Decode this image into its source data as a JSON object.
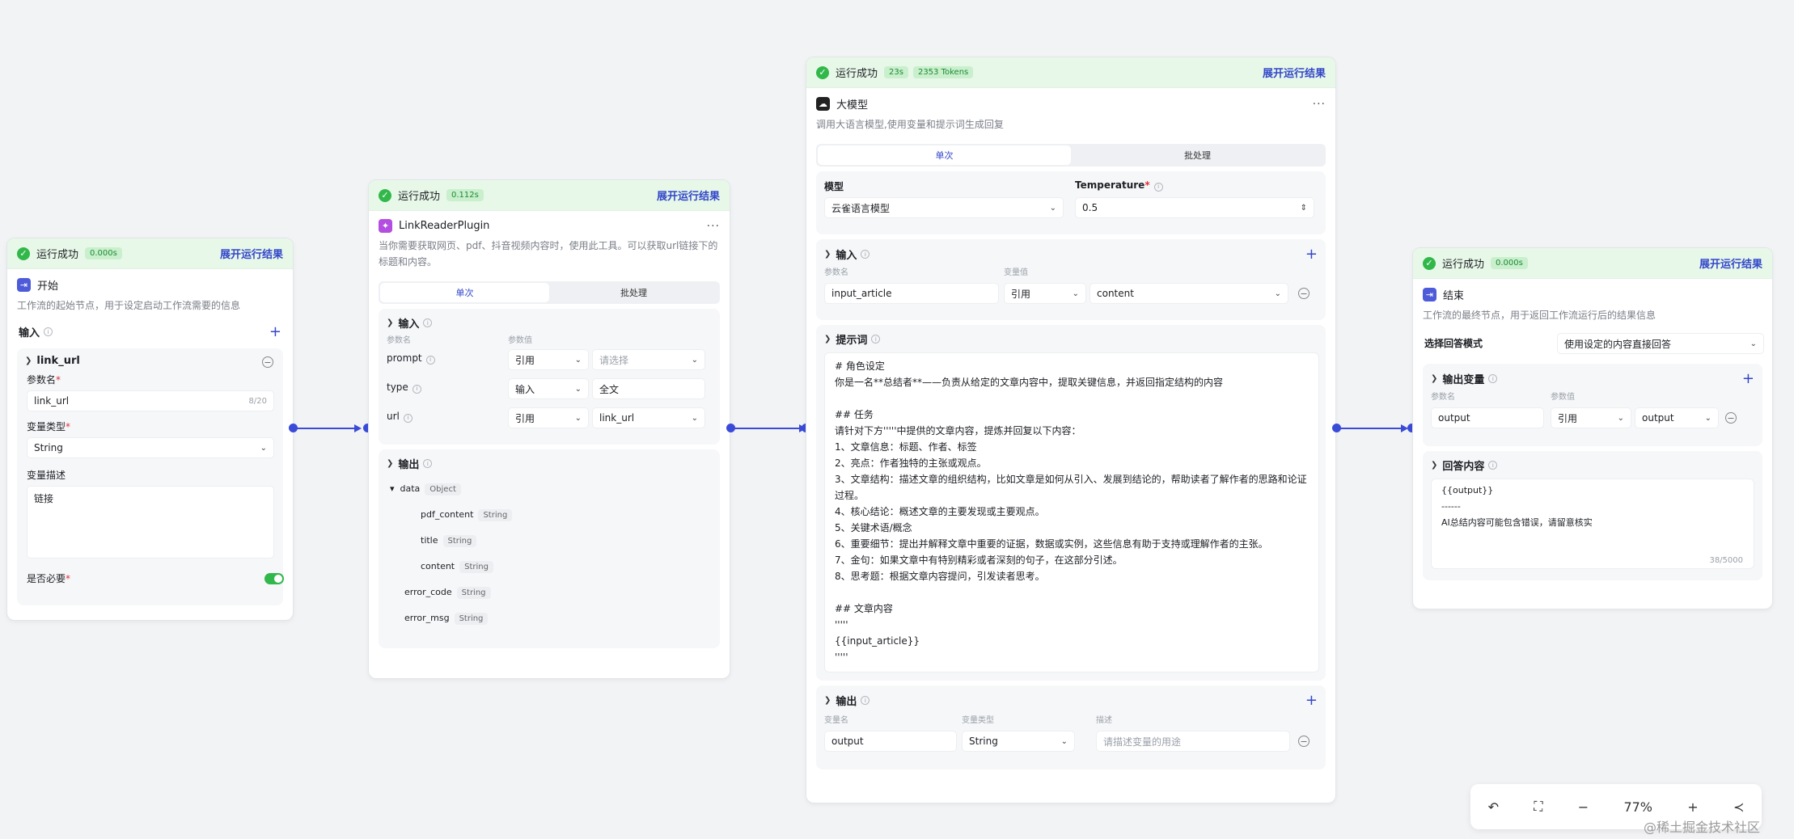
{
  "run": {
    "status": "运行成功",
    "expand": "展开运行结果"
  },
  "start": {
    "time": "0.000s",
    "title": "开始",
    "desc": "工作流的起始节点，用于设定启动工作流需要的信息",
    "input_label": "输入",
    "var_name": "link_url",
    "param_label": "参数名",
    "param_value": "link_url",
    "count": "8/20",
    "type_label": "变量类型",
    "type_value": "String",
    "desc_label": "变量描述",
    "desc_value": "链接",
    "required_label": "是否必要"
  },
  "plugin": {
    "time": "0.112s",
    "title": "LinkReaderPlugin",
    "desc": "当你需要获取网页、pdf、抖音视频内容时，使用此工具。可以获取url链接下的标题和内容。",
    "tab_single": "单次",
    "tab_batch": "批处理",
    "input_label": "输入",
    "col_name": "参数名",
    "col_value": "参数值",
    "rows": [
      {
        "name": "prompt",
        "mode": "引用",
        "value": "请选择"
      },
      {
        "name": "type",
        "mode": "输入",
        "value": "全文"
      },
      {
        "name": "url",
        "mode": "引用",
        "value": "link_url"
      }
    ],
    "output_label": "输出",
    "outputs": [
      {
        "name": "data",
        "type": "Object"
      },
      {
        "name": "pdf_content",
        "type": "String"
      },
      {
        "name": "title",
        "type": "String"
      },
      {
        "name": "content",
        "type": "String"
      },
      {
        "name": "error_code",
        "type": "String"
      },
      {
        "name": "error_msg",
        "type": "String"
      }
    ]
  },
  "llm": {
    "time": "23s",
    "tokens": "2353 Tokens",
    "title": "大模型",
    "desc": "调用大语言模型,使用变量和提示词生成回复",
    "tab_single": "单次",
    "tab_batch": "批处理",
    "model_label": "模型",
    "model_value": "云雀语言模型",
    "temp_label": "Temperature",
    "temp_value": "0.5",
    "input_label": "输入",
    "col_name": "参数名",
    "col_value": "变量值",
    "input_name": "input_article",
    "input_mode": "引用",
    "input_value": "content",
    "prompt_label": "提示词",
    "prompt_text": "# 角色设定\n你是一名**总结者**——负责从给定的文章内容中，提取关键信息，并返回指定结构的内容\n\n## 任务\n请针对下方'''''中提供的文章内容，提炼并回复以下内容：\n1、文章信息：标题、作者、标签\n2、亮点：作者独特的主张或观点。\n3、文章结构：描述文章的组织结构，比如文章是如何从引入、发展到结论的，帮助读者了解作者的思路和论证过程。\n4、核心结论：概述文章的主要发现或主要观点。\n5、关键术语/概念\n6、重要细节：提出并解释文章中重要的证据，数据或实例，这些信息有助于支持或理解作者的主张。\n7、金句：如果文章中有特别精彩或者深刻的句子，在这部分引述。\n8、思考题：根据文章内容提问，引发读者思考。\n\n## 文章内容\n'''''\n{{input_article}}\n'''''",
    "output_label": "输出",
    "col_var": "变量名",
    "col_type": "变量类型",
    "col_desc": "描述",
    "output_name": "output",
    "output_type": "String",
    "output_desc_ph": "请描述变量的用途"
  },
  "end": {
    "time": "0.000s",
    "title": "结束",
    "desc": "工作流的最终节点，用于返回工作流运行后的结果信息",
    "mode_label": "选择回答模式",
    "mode_value": "使用设定的内容直接回答",
    "out_label": "输出变量",
    "col_name": "参数名",
    "col_value": "参数值",
    "out_name": "output",
    "out_mode": "引用",
    "out_value": "output",
    "answer_label": "回答内容",
    "answer_text": "{{output}}\n------\nAI总结内容可能包含错误，请留意核实",
    "answer_count": "38/5000"
  },
  "zoom": {
    "level": "77%"
  },
  "watermark": "@稀土掘金技术社区",
  "colors": {
    "accent": "#3346c9",
    "success": "#32b84a"
  }
}
